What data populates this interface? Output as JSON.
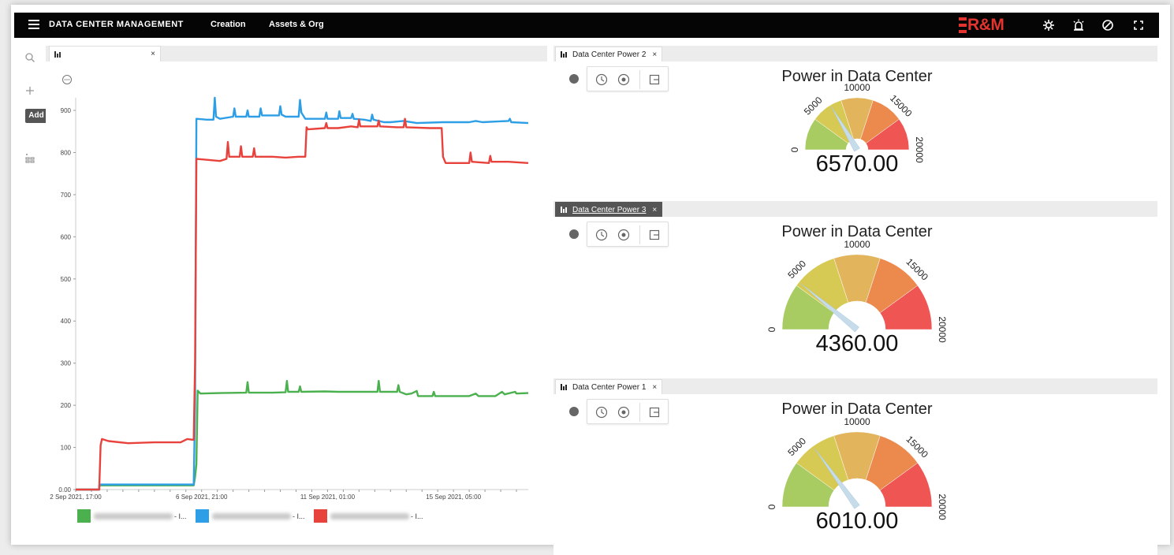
{
  "topbar": {
    "title": "DATA CENTER MANAGEMENT",
    "nav": [
      "Creation",
      "Assets & Org"
    ],
    "logo_text": "R&M",
    "icons": [
      "menu-icon",
      "settings-gear-icon",
      "alarm-icon",
      "check-circle-icon",
      "fullscreen-icon"
    ]
  },
  "rail": {
    "icons": [
      "search-icon",
      "plus-icon",
      "tree-structure-icon"
    ],
    "add_tooltip": "Add"
  },
  "left_panel": {
    "tab_label": "",
    "tab_close": "×"
  },
  "chart_data": {
    "type": "line",
    "title": "",
    "xlabel": "",
    "ylabel": "",
    "ylim": [
      0,
      930
    ],
    "yticks": [
      "0.00",
      "100",
      "200",
      "300",
      "400",
      "500",
      "600",
      "700",
      "800",
      "900"
    ],
    "xticks": [
      "2 Sep 2021, 17:00",
      "6 Sep 2021, 21:00",
      "11 Sep 2021, 01:00",
      "15 Sep 2021, 05:00"
    ],
    "x_unit_note": "hours after 2 Sep 2021, 17:00",
    "series": [
      {
        "name": "- I...",
        "color": "#4bb04e",
        "points": [
          [
            0,
            0
          ],
          [
            18,
            0
          ],
          [
            18,
            8
          ],
          [
            19,
            10
          ],
          [
            40,
            10
          ],
          [
            60,
            10
          ],
          [
            80,
            10
          ],
          [
            90,
            10
          ],
          [
            91,
            30
          ],
          [
            92,
            60
          ],
          [
            93,
            235
          ],
          [
            95,
            228
          ],
          [
            110,
            229
          ],
          [
            130,
            230
          ],
          [
            131,
            255
          ],
          [
            132,
            230
          ],
          [
            150,
            230
          ],
          [
            160,
            231
          ],
          [
            161,
            258
          ],
          [
            162,
            232
          ],
          [
            170,
            232
          ],
          [
            171,
            245
          ],
          [
            172,
            232
          ],
          [
            190,
            233
          ],
          [
            200,
            232
          ],
          [
            230,
            232
          ],
          [
            231,
            258
          ],
          [
            232,
            232
          ],
          [
            245,
            232
          ],
          [
            246,
            248
          ],
          [
            247,
            232
          ],
          [
            252,
            226
          ],
          [
            256,
            228
          ],
          [
            260,
            234
          ],
          [
            261,
            222
          ],
          [
            272,
            222
          ],
          [
            273,
            232
          ],
          [
            274,
            222
          ],
          [
            300,
            222
          ],
          [
            305,
            228
          ],
          [
            307,
            222
          ],
          [
            320,
            222
          ],
          [
            325,
            232
          ],
          [
            327,
            226
          ],
          [
            335,
            232
          ],
          [
            336,
            228
          ],
          [
            345,
            229
          ]
        ]
      },
      {
        "name": "- I...",
        "color": "#2e9ee6",
        "points": [
          [
            0,
            0
          ],
          [
            18,
            0
          ],
          [
            18,
            10
          ],
          [
            19,
            12
          ],
          [
            40,
            12
          ],
          [
            60,
            12
          ],
          [
            80,
            12
          ],
          [
            90,
            12
          ],
          [
            91,
            200
          ],
          [
            92,
            880
          ],
          [
            100,
            878
          ],
          [
            105,
            878
          ],
          [
            106,
            930
          ],
          [
            107,
            885
          ],
          [
            110,
            880
          ],
          [
            120,
            885
          ],
          [
            121,
            905
          ],
          [
            122,
            885
          ],
          [
            130,
            885
          ],
          [
            131,
            900
          ],
          [
            132,
            885
          ],
          [
            140,
            885
          ],
          [
            141,
            905
          ],
          [
            142,
            888
          ],
          [
            155,
            888
          ],
          [
            156,
            910
          ],
          [
            157,
            890
          ],
          [
            160,
            885
          ],
          [
            170,
            885
          ],
          [
            171,
            925
          ],
          [
            172,
            895
          ],
          [
            175,
            880
          ],
          [
            190,
            880
          ],
          [
            191,
            895
          ],
          [
            192,
            880
          ],
          [
            200,
            880
          ],
          [
            201,
            898
          ],
          [
            202,
            882
          ],
          [
            210,
            882
          ],
          [
            211,
            892
          ],
          [
            212,
            880
          ],
          [
            220,
            878
          ],
          [
            225,
            875
          ],
          [
            226,
            890
          ],
          [
            227,
            878
          ],
          [
            235,
            872
          ],
          [
            240,
            872
          ],
          [
            250,
            875
          ],
          [
            260,
            870
          ],
          [
            280,
            872
          ],
          [
            300,
            872
          ],
          [
            305,
            875
          ],
          [
            310,
            872
          ],
          [
            330,
            875
          ],
          [
            331,
            880
          ],
          [
            332,
            872
          ],
          [
            345,
            870
          ]
        ]
      },
      {
        "name": "- I...",
        "color": "#e8423c",
        "points": [
          [
            0,
            0
          ],
          [
            18,
            0
          ],
          [
            18,
            5
          ],
          [
            19,
            105
          ],
          [
            20,
            120
          ],
          [
            25,
            115
          ],
          [
            40,
            110
          ],
          [
            60,
            112
          ],
          [
            80,
            112
          ],
          [
            85,
            120
          ],
          [
            90,
            118
          ],
          [
            91,
            300
          ],
          [
            92,
            785
          ],
          [
            110,
            780
          ],
          [
            115,
            785
          ],
          [
            116,
            825
          ],
          [
            117,
            790
          ],
          [
            125,
            790
          ],
          [
            126,
            815
          ],
          [
            127,
            790
          ],
          [
            135,
            790
          ],
          [
            136,
            810
          ],
          [
            137,
            790
          ],
          [
            150,
            790
          ],
          [
            160,
            788
          ],
          [
            170,
            790
          ],
          [
            175,
            790
          ],
          [
            176,
            860
          ],
          [
            177,
            855
          ],
          [
            190,
            858
          ],
          [
            191,
            870
          ],
          [
            192,
            858
          ],
          [
            200,
            858
          ],
          [
            210,
            862
          ],
          [
            215,
            860
          ],
          [
            216,
            878
          ],
          [
            217,
            862
          ],
          [
            230,
            862
          ],
          [
            231,
            876
          ],
          [
            232,
            862
          ],
          [
            245,
            860
          ],
          [
            250,
            860
          ],
          [
            251,
            880
          ],
          [
            252,
            860
          ],
          [
            270,
            858
          ],
          [
            279,
            858
          ],
          [
            280,
            790
          ],
          [
            282,
            775
          ],
          [
            300,
            775
          ],
          [
            301,
            800
          ],
          [
            302,
            778
          ],
          [
            315,
            775
          ],
          [
            316,
            792
          ],
          [
            317,
            778
          ],
          [
            330,
            778
          ],
          [
            345,
            775
          ]
        ]
      }
    ],
    "legend": [
      "- I...",
      "- I...",
      "- I..."
    ]
  },
  "widgets": [
    {
      "tab_label": "Data Center Power 2",
      "active": false,
      "gauge_title": "Power in Data Center",
      "value": 6570,
      "value_text": "6570.00",
      "max": 20000,
      "tick_labels": [
        "0",
        "5000",
        "10000",
        "15000",
        "20000"
      ]
    },
    {
      "tab_label": "Data Center Power 3",
      "active": true,
      "gauge_title": "Power in Data Center",
      "value": 4360,
      "value_text": "4360.00",
      "max": 20000,
      "tick_labels": [
        "0",
        "5000",
        "10000",
        "15000",
        "20000"
      ]
    },
    {
      "tab_label": "Data Center Power 1",
      "active": false,
      "gauge_title": "Power in Data Center",
      "value": 6010,
      "value_text": "6010.00",
      "max": 20000,
      "tick_labels": [
        "0",
        "5000",
        "10000",
        "15000",
        "20000"
      ]
    }
  ],
  "colors": {
    "topbar": "#050505",
    "brand_red": "#e3342f",
    "band_colors": [
      "#a8cc62",
      "#d6ca55",
      "#e2b45c",
      "#ec8a4e",
      "#ee5553"
    ]
  },
  "gauge_tool_icons": [
    "clock-icon",
    "clock-refresh-icon",
    "export-icon"
  ],
  "close_glyph": "×"
}
